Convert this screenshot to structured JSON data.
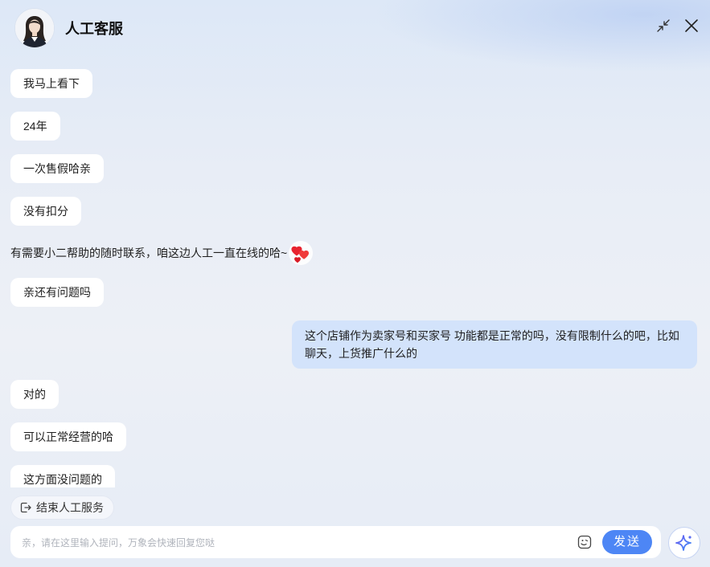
{
  "header": {
    "title": "人工客服",
    "icons": [
      "avatar",
      "minimize-icon",
      "close-icon"
    ]
  },
  "messages": [
    {
      "side": "agent",
      "text": "我马上看下"
    },
    {
      "side": "agent",
      "text": "24年"
    },
    {
      "side": "agent",
      "text": "一次售假哈亲"
    },
    {
      "side": "agent",
      "text": "没有扣分"
    },
    {
      "side": "agent",
      "text": "有需要小二帮助的随时联系，咱这边人工一直在线的哈~",
      "emoji": "hearts-emoji"
    },
    {
      "side": "agent",
      "text": "亲还有问题吗"
    },
    {
      "side": "user",
      "text": "这个店铺作为卖家号和买家号 功能都是正常的吗，没有限制什么的吧，比如聊天，上货推广什么的"
    },
    {
      "side": "agent",
      "text": "对的"
    },
    {
      "side": "agent",
      "text": "可以正常经营的哈"
    },
    {
      "side": "agent",
      "text": "这方面没问题的"
    }
  ],
  "actions": {
    "end_service_label": "结束人工服务"
  },
  "composer": {
    "placeholder": "亲，请在这里输入提问，万象会快速回复您哒",
    "value": "",
    "send_label": "发送"
  },
  "colors": {
    "send_button": "#4d86f5",
    "user_bubble": "#d3e3fb",
    "agent_bubble": "#ffffff"
  }
}
